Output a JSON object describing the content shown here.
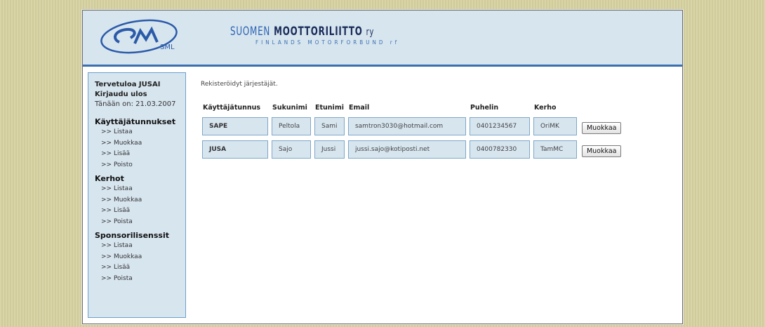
{
  "header": {
    "logo_text": "SML",
    "brand_part1": "SUOMEN",
    "brand_part2": "MOOTTORILIITTO",
    "brand_part3": "ry",
    "brand_sub": "FINLANDS MOTORFORBUND rf"
  },
  "sidebar": {
    "welcome": "Tervetuloa JUSAI",
    "logout": "Kirjaudu ulos",
    "date": "Tänään on: 21.03.2007",
    "sections": [
      {
        "title": "Käyttäjätunnukset",
        "links": [
          ">> Listaa",
          ">> Muokkaa",
          ">> Lisää",
          ">> Poisto"
        ]
      },
      {
        "title": "Kerhot",
        "links": [
          ">> Listaa",
          ">> Muokkaa",
          ">> Lisää",
          ">> Poista"
        ]
      },
      {
        "title": "Sponsorilisenssit",
        "links": [
          ">> Listaa",
          ">> Muokkaa",
          ">> Lisää",
          ">> Poista"
        ]
      }
    ]
  },
  "main": {
    "intro": "Rekisteröidyt järjestäjät.",
    "columns": [
      "Käyttäjätunnus",
      "Sukunimi",
      "Etunimi",
      "Email",
      "Puhelin",
      "Kerho"
    ],
    "rows": [
      {
        "user": "SAPE",
        "last": "Peltola",
        "first": "Sami",
        "email": "samtron3030@hotmail.com",
        "phone": "0401234567",
        "club": "OriMK",
        "button": "Muokkaa"
      },
      {
        "user": "JUSA",
        "last": "Sajo",
        "first": "Jussi",
        "email": "jussi.sajo@kotiposti.net",
        "phone": "0400782330",
        "club": "TamMC",
        "button": "Muokkaa"
      }
    ]
  },
  "colors": {
    "accent": "#3a6fb0",
    "panel": "#d7e5ef",
    "border": "#7fa7c9"
  }
}
